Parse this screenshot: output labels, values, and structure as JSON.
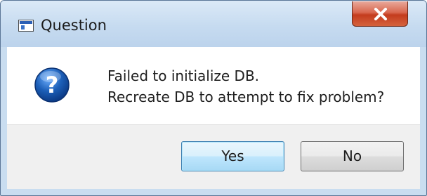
{
  "window": {
    "title": "Question",
    "icon": "app-window-icon",
    "close_icon": "close-icon"
  },
  "message": {
    "icon": "question-icon",
    "line1": "Failed to initialize DB.",
    "line2": "Recreate DB to attempt to fix problem?"
  },
  "buttons": {
    "yes_label": "Yes",
    "no_label": "No",
    "default": "Yes"
  },
  "colors": {
    "titlebar": "#c6dbf0",
    "close_button": "#c43c1e",
    "question_icon": "#1c5fb8",
    "default_button_border": "#3c7fb1"
  }
}
